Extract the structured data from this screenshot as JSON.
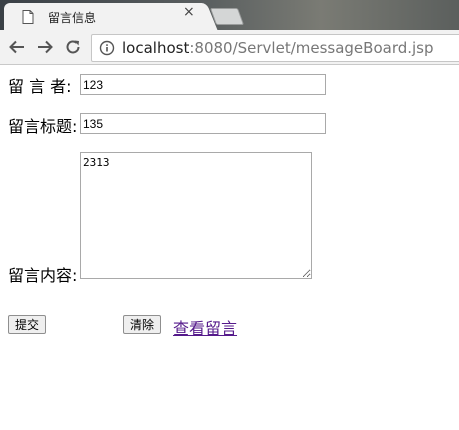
{
  "browser": {
    "tab_title": "留言信息",
    "tab_close": "×",
    "url_host": "localhost",
    "url_rest": ":8080/Servlet/messageBoard.jsp"
  },
  "form": {
    "author": {
      "label": "留 言 者:",
      "value": "123"
    },
    "title": {
      "label": "留言标题:",
      "value": "135"
    },
    "content": {
      "label": "留言内容:",
      "value": "2313"
    },
    "submit_label": "提交",
    "reset_label": "清除",
    "view_link": "查看留言"
  },
  "colors": {
    "link": "#551a8b",
    "input_border": "#a9a9a9"
  },
  "icons": [
    "page-icon",
    "back-arrow-icon",
    "forward-arrow-icon",
    "reload-icon",
    "info-icon"
  ]
}
